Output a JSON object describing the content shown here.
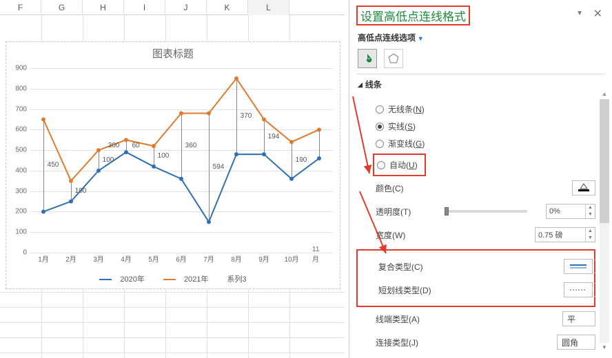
{
  "columns": [
    "F",
    "G",
    "H",
    "I",
    "J",
    "K",
    "L"
  ],
  "chart_data": {
    "type": "line",
    "title": "图表标题",
    "categories": [
      "1月",
      "2月",
      "3月",
      "4月",
      "5月",
      "6月",
      "7月",
      "8月",
      "9月",
      "10月",
      "11月"
    ],
    "ylim": [
      0,
      900
    ],
    "series": [
      {
        "name": "2020年",
        "color": "#2f6fb7",
        "values": [
          200,
          250,
          400,
          490,
          420,
          360,
          150,
          480,
          480,
          360,
          460
        ]
      },
      {
        "name": "2021年",
        "color": "#e07b2e",
        "values": [
          650,
          350,
          500,
          550,
          520,
          680,
          680,
          850,
          650,
          540,
          600
        ]
      }
    ],
    "third_series_label": "系列3",
    "xlabel": "",
    "ylabel": "",
    "yticks": [
      0,
      100,
      200,
      300,
      400,
      500,
      600,
      700,
      800,
      900
    ],
    "data_labels": [
      {
        "i": 0,
        "v": 450
      },
      {
        "i": 1,
        "v": 100
      },
      {
        "i": 2,
        "v": 100
      },
      {
        "i": 3,
        "v": 60,
        "pre": "300"
      },
      {
        "i": 4,
        "v": 100
      },
      {
        "i": 5,
        "v": 360
      },
      {
        "i": 6,
        "v": 594
      },
      {
        "i": 7,
        "v": 370
      },
      {
        "i": 8,
        "v": 194
      },
      {
        "i": 9,
        "v": 190
      }
    ]
  },
  "pane": {
    "title": "设置高低点连线格式",
    "options_link": "高低点连线选项",
    "section": "线条",
    "radios": {
      "none": {
        "label": "无线条",
        "key": "N"
      },
      "solid": {
        "label": "实线",
        "key": "S"
      },
      "grad": {
        "label": "渐变线",
        "key": "G"
      },
      "auto": {
        "label": "自动",
        "key": "U"
      }
    },
    "selected_radio": "solid",
    "color_label": "颜色(C)",
    "opacity_label": "透明度(T)",
    "opacity_value": "0%",
    "width_label": "宽度(W)",
    "width_value": "0.75 磅",
    "compound_label": "复合类型(C)",
    "dash_label": "短划线类型(D)",
    "cap_label": "线端类型(A)",
    "cap_value": "平",
    "join_label": "连接类型(J)",
    "join_value": "圆角"
  }
}
